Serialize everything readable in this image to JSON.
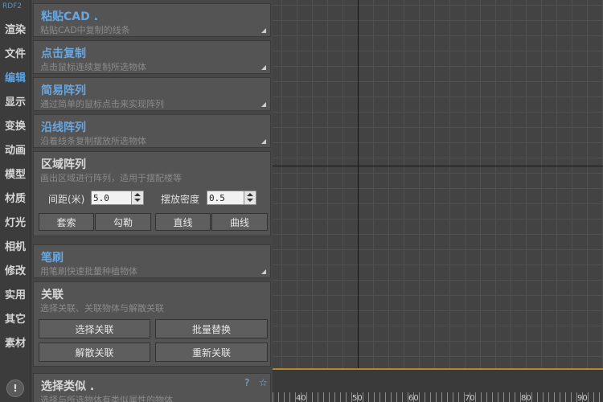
{
  "sidebar": {
    "brand": "RDF2",
    "tabs": [
      "渲染",
      "文件",
      "编辑",
      "显示",
      "变换",
      "动画",
      "模型",
      "材质",
      "灯光",
      "相机",
      "修改",
      "实用",
      "其它",
      "素材"
    ],
    "active_tab": "编辑",
    "info_icon": "!"
  },
  "sections": {
    "paste_cad": {
      "title": "粘贴CAD .",
      "desc": "粘贴CAD中复制的线条"
    },
    "click_copy": {
      "title": "点击复制",
      "desc": "点击鼠标连续复制所选物体"
    },
    "simple_array": {
      "title": "简易阵列",
      "desc": "通过简单的鼠标点击来实现阵列"
    },
    "path_array": {
      "title": "沿线阵列",
      "desc": "沿着线条复制摆放所选物体"
    },
    "area_array": {
      "title": "区域阵列",
      "desc": "画出区域进行阵列，适用于摆配楼等",
      "spacing_label": "间距(米)",
      "spacing_value": "5.0",
      "density_label": "摆放密度",
      "density_value": "0.5",
      "buttons": [
        "套索",
        "勾勒",
        "直线",
        "曲线"
      ]
    },
    "brush": {
      "title": "笔刷",
      "desc": "用笔刷快速批量种植物体"
    },
    "link": {
      "title": "关联",
      "desc": "选择关联、关联物体与解散关联",
      "buttons": [
        "选择关联",
        "批量替换",
        "解散关联",
        "重新关联"
      ]
    },
    "select_similar": {
      "title": "选择类似 .",
      "desc": "选择与所选物体有类似属性的物体",
      "help_icon": "?",
      "star_icon": "☆"
    }
  },
  "timeline": {
    "labels": [
      "40",
      "50",
      "60",
      "70",
      "80",
      "90"
    ]
  },
  "colors": {
    "accent": "#6aa6dd",
    "timeline_track": "#b08a2a"
  }
}
